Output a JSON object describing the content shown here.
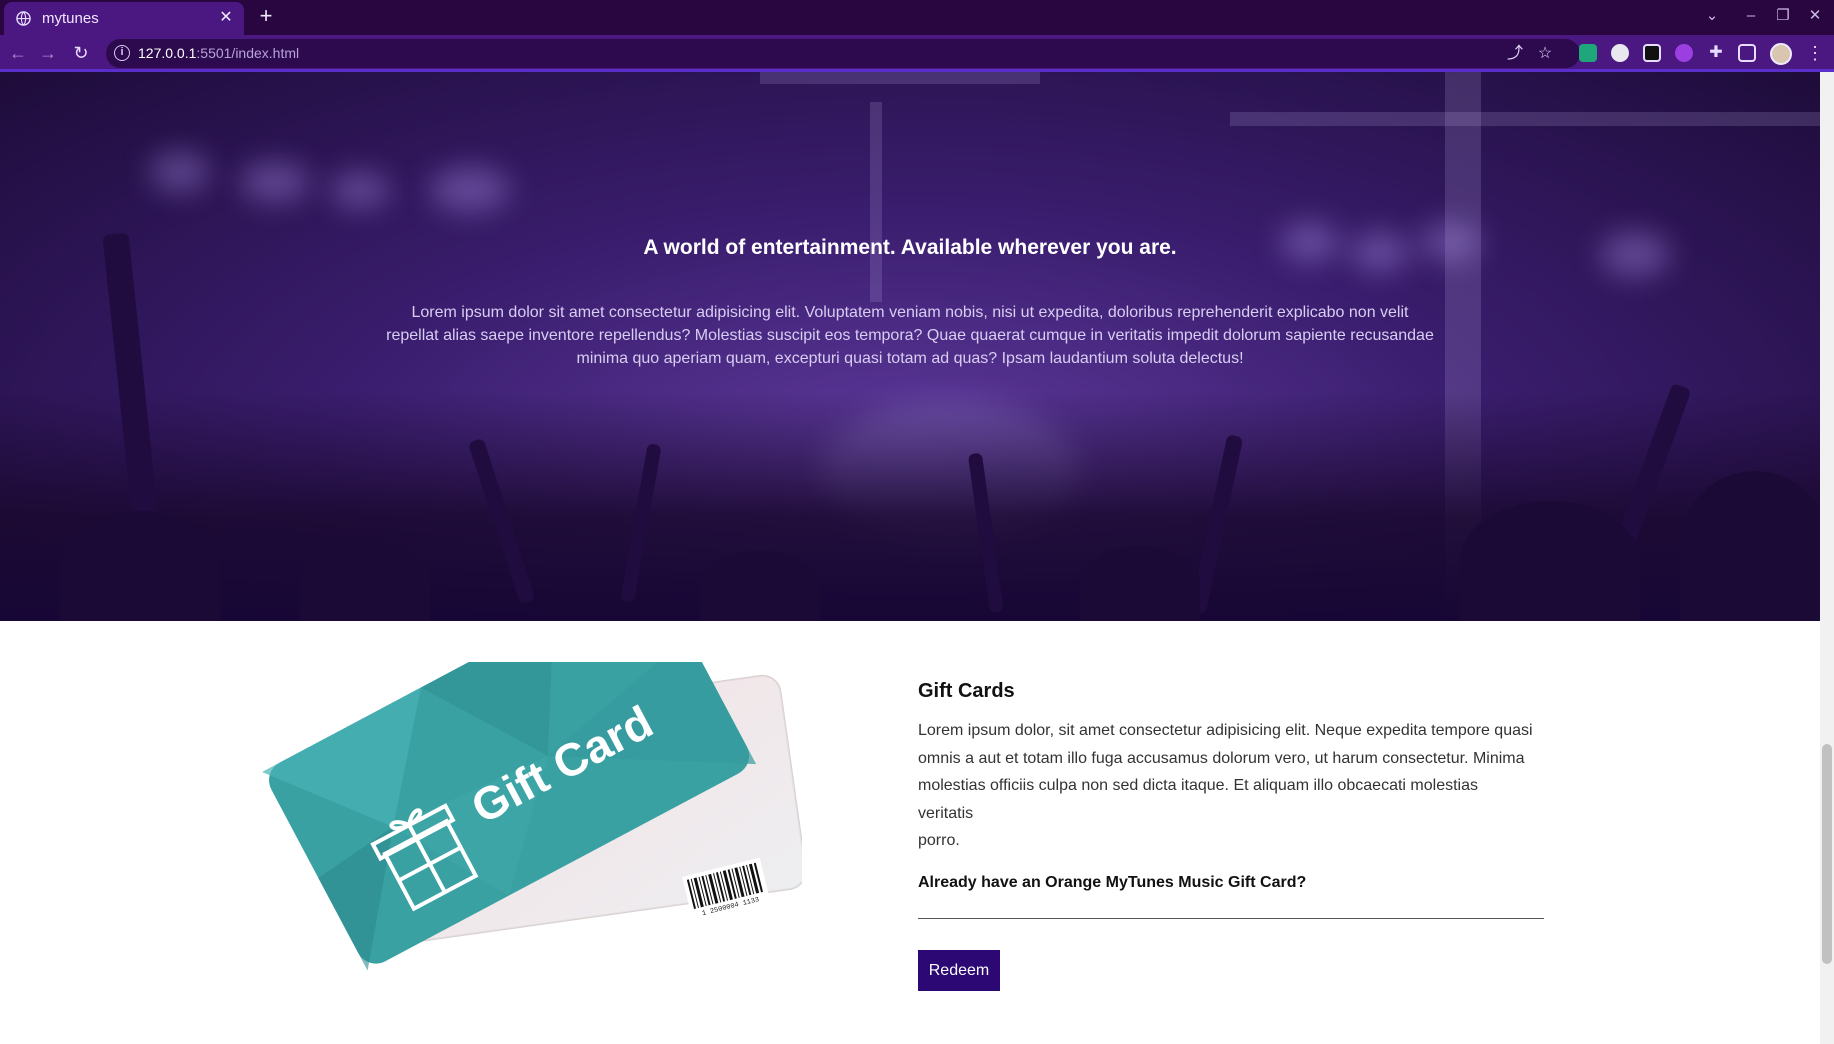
{
  "browser": {
    "tab_title": "mytunes",
    "tab_close": "✕",
    "new_tab": "+",
    "url_host": "127.0.0.1",
    "url_path": ":5501/index.html",
    "colors": {
      "tabbar": "#2a0640",
      "toolbar": "#4a1880",
      "omnibox": "#2d0a4e"
    }
  },
  "hero": {
    "title": "A world of entertainment. Available wherever you are.",
    "text": "Lorem ipsum dolor sit amet consectetur adipisicing elit. Voluptatem veniam nobis, nisi ut expedita, doloribus reprehenderit explicabo non velit repellat alias saepe inventore repellendus? Molestias suscipit eos tempora? Quae quaerat cumque in veritatis impedit dolorum sapiente recusandae minima quo aperiam quam, excepturi quasi totam ad quas? Ipsam laudantium soluta delectus!"
  },
  "gift": {
    "image_text": "Gift Card",
    "barcode_number": "1 2500004 1133",
    "heading": "Gift Cards",
    "desc_lines": [
      "Lorem ipsum dolor, sit amet consectetur adipisicing elit. Neque expedita tempore quasi",
      "omnis a aut et totam illo fuga accusamus dolorum vero, ut harum consectetur. Minima",
      "molestias officiis culpa non sed dicta itaque. Et aliquam illo obcaecati molestias",
      "veritatis",
      "porro."
    ],
    "question": "Already have an Orange MyTunes Music Gift Card?",
    "button_label": "Redeem",
    "button_color": "#2c0874"
  }
}
